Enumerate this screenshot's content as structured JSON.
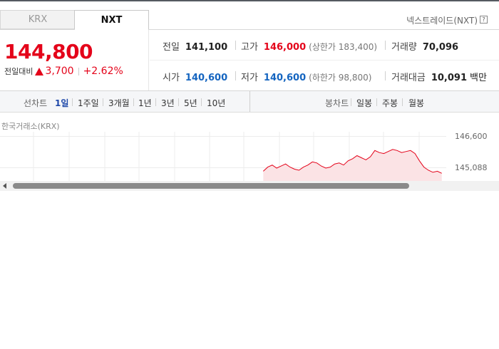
{
  "tabs": {
    "krx": "KRX",
    "nxt": "NXT"
  },
  "venue_label": "넥스트레이드(NXT)",
  "help_icon": "?",
  "price": {
    "current": "144,800",
    "change_label": "전일대비",
    "change_value": "3,700",
    "change_pct": "+2.62%"
  },
  "stats": {
    "prev_close_label": "전일",
    "prev_close": "141,100",
    "high_label": "고가",
    "high": "146,000",
    "upper_limit": "(상한가 183,400)",
    "volume_label": "거래량",
    "volume": "70,096",
    "open_label": "시가",
    "open": "140,600",
    "low_label": "저가",
    "low": "140,600",
    "lower_limit": "(하한가 98,800)",
    "amount_label": "거래대금",
    "amount": "10,091",
    "amount_unit": "백만"
  },
  "period_bar": {
    "line_label": "선차트",
    "line_items": [
      "1일",
      "1주일",
      "3개월",
      "1년",
      "3년",
      "5년",
      "10년"
    ],
    "active_item": "1일",
    "candle_label": "봉차트",
    "candle_items": [
      "일봉",
      "주봉",
      "월봉"
    ]
  },
  "chart_title": "한국거래소(KRX)",
  "colors": {
    "up": "#e4031a",
    "down": "#1565c0",
    "active": "#1d47a8"
  },
  "chart_data": {
    "type": "area",
    "y_tick_labels": [
      "146,600",
      "145,088"
    ],
    "y_ticks": [
      146600,
      145088
    ],
    "ylim": [
      144400,
      146800
    ],
    "x_index_range": [
      0,
      200
    ],
    "x": [
      118,
      120,
      122,
      124,
      126,
      128,
      130,
      132,
      134,
      136,
      138,
      140,
      142,
      144,
      146,
      148,
      150,
      152,
      154,
      156,
      158,
      160,
      162,
      164,
      166,
      168,
      170,
      172,
      174,
      176,
      178,
      180,
      182,
      184,
      186,
      188,
      190,
      192,
      194,
      196,
      198
    ],
    "values": [
      144900,
      145100,
      145200,
      145050,
      145150,
      145250,
      145100,
      145000,
      144950,
      145100,
      145200,
      145350,
      145300,
      145150,
      145050,
      145100,
      145250,
      145300,
      145200,
      145400,
      145500,
      145650,
      145550,
      145450,
      145600,
      145900,
      145800,
      145750,
      145850,
      145950,
      145900,
      145800,
      145850,
      145900,
      145750,
      145400,
      145100,
      144950,
      144850,
      144900,
      144800
    ],
    "grid": true,
    "line_color": "#e4031a",
    "fill_color": "#fbe3e5"
  }
}
